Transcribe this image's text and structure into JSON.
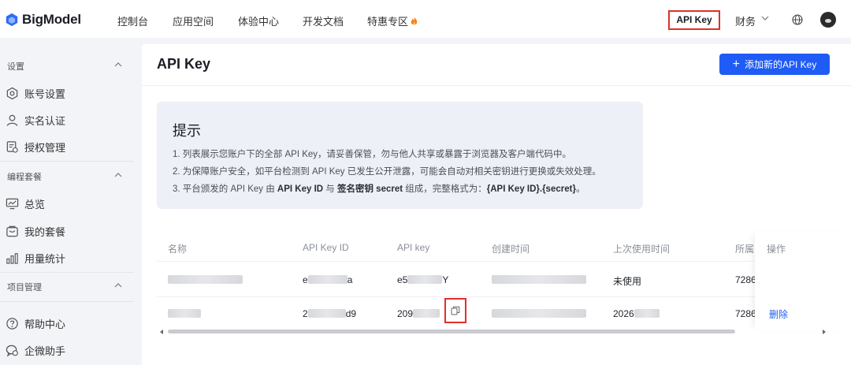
{
  "brand": {
    "name": "BigModel"
  },
  "nav": {
    "items": [
      "控制台",
      "应用空间",
      "体验中心",
      "开发文档",
      "特惠专区"
    ]
  },
  "header": {
    "api_key": "API Key",
    "finance": "财务"
  },
  "sidebar": {
    "sections": [
      {
        "title": "设置",
        "items": [
          "账号设置",
          "实名认证",
          "授权管理"
        ]
      },
      {
        "title": "编程套餐",
        "items": [
          "总览",
          "我的套餐",
          "用量统计"
        ]
      },
      {
        "title": "项目管理",
        "items": []
      }
    ],
    "bottom": [
      "帮助中心",
      "企微助手"
    ]
  },
  "page": {
    "title": "API Key",
    "add_button": "添加新的API Key"
  },
  "tip": {
    "title": "提示",
    "line1": "1. 列表展示您账户下的全部 API Key，请妥善保管，勿与他人共享或暴露于浏览器及客户端代码中。",
    "line2": "2. 为保障账户安全，如平台检测到 API Key 已发生公开泄露，可能会自动对相关密钥进行更换或失效处理。",
    "line3_a": "3. 平台颁发的 API Key 由 ",
    "line3_b": "API Key ID",
    "line3_c": " 与 ",
    "line3_d": "签名密钥 secret",
    "line3_e": " 组成，完整格式为：",
    "line3_f": "{API Key ID}.{secret}",
    "line3_g": "。"
  },
  "table": {
    "headers": [
      "名称",
      "API Key ID",
      "API key",
      "创建时间",
      "上次使用时间",
      "所属",
      "操作"
    ],
    "rows": [
      {
        "id_prefix": "e",
        "id_suffix": "a",
        "key_prefix": "e5",
        "key_suffix": "Y",
        "last_used": "未使用",
        "owner": "7286",
        "action": ""
      },
      {
        "id_prefix": "2",
        "id_suffix": "d9",
        "key_prefix": "209",
        "key_suffix": "",
        "last_used": "2026",
        "owner": "7286",
        "action": "删除"
      }
    ]
  },
  "colors": {
    "accent": "#1f5bf5",
    "highlight": "#e0302b"
  }
}
